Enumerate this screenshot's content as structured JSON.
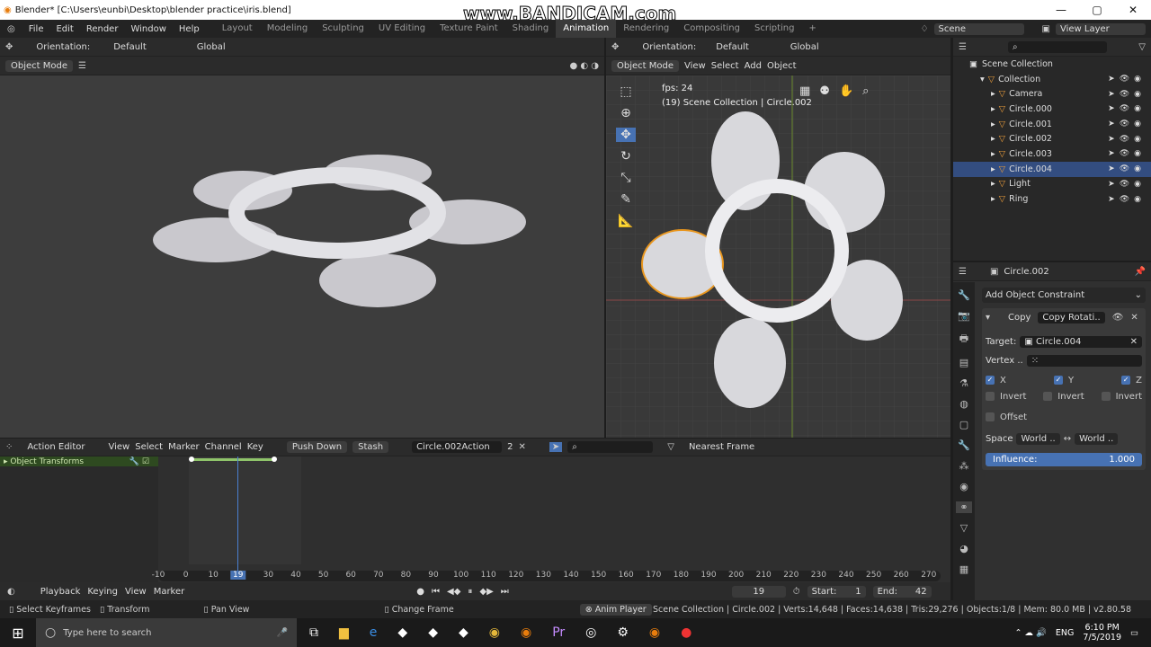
{
  "window": {
    "title": "Blender* [C:\\Users\\eunbi\\Desktop\\blender practice\\iris.blend]",
    "watermark": "www.BANDICAM.com"
  },
  "menu": [
    "File",
    "Edit",
    "Render",
    "Window",
    "Help"
  ],
  "workspaces": [
    "Layout",
    "Modeling",
    "Sculpting",
    "UV Editing",
    "Texture Paint",
    "Shading",
    "Animation",
    "Rendering",
    "Compositing",
    "Scripting",
    "+"
  ],
  "scene": "Scene",
  "view_layer": "View Layer",
  "left_viewport": {
    "orientation_label": "Orientation:",
    "orientation": "Default",
    "transform": "Global",
    "mode": "Object Mode"
  },
  "right_viewport": {
    "orientation_label": "Orientation:",
    "orientation": "Default",
    "transform": "Global",
    "mode": "Object Mode",
    "menus": [
      "View",
      "Select",
      "Add",
      "Object"
    ],
    "fps": "fps: 24",
    "info": "(19) Scene Collection | Circle.002"
  },
  "outliner": {
    "root": "Scene Collection",
    "items": [
      {
        "name": "Collection",
        "indent": 1
      },
      {
        "name": "Camera",
        "indent": 2
      },
      {
        "name": "Circle.000",
        "indent": 2
      },
      {
        "name": "Circle.001",
        "indent": 2
      },
      {
        "name": "Circle.002",
        "indent": 2
      },
      {
        "name": "Circle.003",
        "indent": 2
      },
      {
        "name": "Circle.004",
        "indent": 2,
        "selected": true
      },
      {
        "name": "Light",
        "indent": 2
      },
      {
        "name": "Ring",
        "indent": 2
      }
    ]
  },
  "properties": {
    "object": "Circle.002",
    "add_constraint": "Add Object Constraint",
    "constraint_short": "Copy",
    "constraint_name": "Copy Rotati..",
    "target_label": "Target:",
    "target": "Circle.004",
    "vertex_label": "Vertex ..",
    "axes": [
      "X",
      "Y",
      "Z"
    ],
    "invert": "Invert",
    "offset": "Offset",
    "space_label": "Space",
    "space_owner": "World ..",
    "space_target": "World ..",
    "influence_label": "Influence:",
    "influence": "1.000"
  },
  "action_editor": {
    "mode": "Action Editor",
    "menus": [
      "View",
      "Select",
      "Marker",
      "Channel",
      "Key"
    ],
    "push_down": "Push Down",
    "stash": "Stash",
    "action": "Circle.002Action",
    "users": "2",
    "snap": "Nearest Frame",
    "channel": "Object Transforms",
    "ticks": [
      "-10",
      "0",
      "10",
      "19",
      "30",
      "40",
      "50",
      "60",
      "70",
      "80",
      "90",
      "100",
      "110",
      "120",
      "130",
      "140",
      "150",
      "160",
      "170",
      "180",
      "190",
      "200",
      "210",
      "220",
      "230",
      "240",
      "250",
      "260",
      "270"
    ]
  },
  "timeline": {
    "menus": [
      "Playback",
      "Keying",
      "View",
      "Marker"
    ],
    "current_frame": "19",
    "start_label": "Start:",
    "start": "1",
    "end_label": "End:",
    "end": "42"
  },
  "status": {
    "select": "Select Keyframes",
    "transform": "Transform",
    "pan": "Pan View",
    "change_frame": "Change Frame",
    "anim_player": "Anim Player",
    "info": "Scene Collection | Circle.002 | Verts:14,648 | Faces:14,638 | Tris:29,276 | Objects:1/8 | Mem: 80.0 MB | v2.80.58"
  },
  "taskbar": {
    "search": "Type here to search",
    "time": "6:10 PM",
    "date": "7/5/2019",
    "lang": "ENG"
  }
}
